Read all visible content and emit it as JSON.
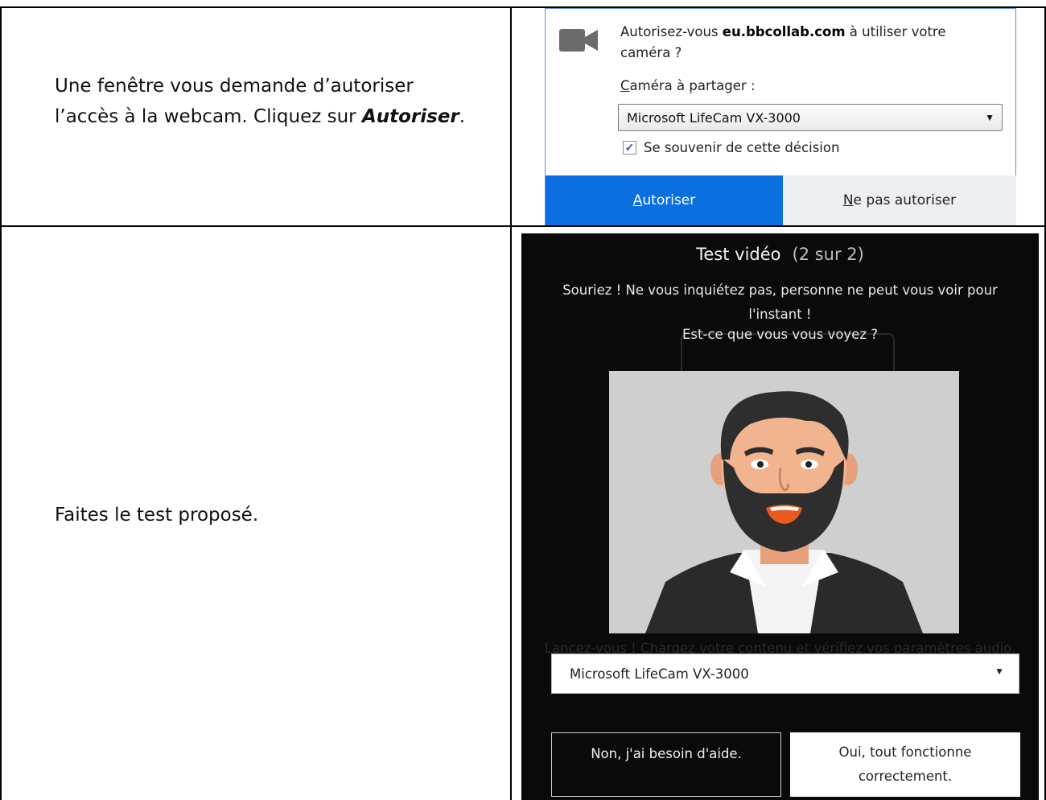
{
  "rows": [
    {
      "instruction_parts": [
        "Une fenêtre vous demande d’autoriser",
        "l’accès à la webcam. Cliquez sur ",
        "Autoriser",
        "."
      ]
    },
    {
      "instruction": "Faites le test proposé."
    }
  ],
  "permission_dialog": {
    "prompt_prefix": "Autorisez-vous ",
    "domain": "eu.bbcollab.com",
    "prompt_suffix": " à utiliser votre caméra ?",
    "camera_label_accesskey": "C",
    "camera_label_rest": "améra à partager :",
    "camera_value": "Microsoft LifeCam VX-3000",
    "remember_label": "Se souvenir de cette décision",
    "remember_checked": true,
    "allow_accesskey": "A",
    "allow_rest": "utoriser",
    "deny_accesskey": "N",
    "deny_rest": "e pas autoriser",
    "colors": {
      "allow_bg": "#0b6fe0",
      "deny_bg": "#eceef2"
    }
  },
  "video_test": {
    "title": "Test vidéo",
    "step": "(2 sur 2)",
    "message": "Souriez ! Ne vous inquiétez pas, personne ne peut vous voir pour l'instant !",
    "question": "Est-ce que vous vous voyez ?",
    "background_text": "Lancez-vous ! Chargez votre contenu et vérifiez vos paramètres audio.",
    "camera_value": "Microsoft LifeCam VX-3000",
    "no_button": "Non, j'ai besoin d'aide.",
    "yes_button": "Oui, tout fonctionne correctement.",
    "icons": [
      "video-camera-icon",
      "dropdown-arrow-icon",
      "checkmark-icon"
    ]
  }
}
